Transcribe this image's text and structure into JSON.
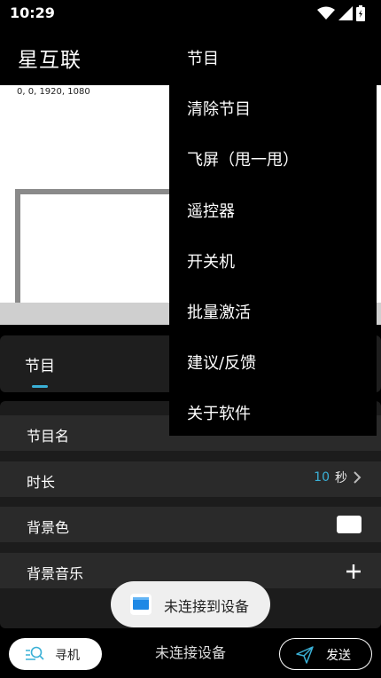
{
  "status": {
    "time": "10:29"
  },
  "app": {
    "title": "星互联"
  },
  "preview": {
    "coords": "0, 0, 1920, 1080"
  },
  "tabs": {
    "active": "节目"
  },
  "settings": {
    "program_name_label": "节目名",
    "duration_label": "时长",
    "duration_value": "10",
    "duration_unit": "秒",
    "background_color_label": "背景色",
    "background_music_label": "背景音乐"
  },
  "toast": {
    "text": "未连接到设备"
  },
  "bottom": {
    "search_label": "寻机",
    "status": "未连接设备",
    "send_label": "发送"
  },
  "menu": {
    "items": [
      "节目",
      "清除节目",
      "飞屏（甩一甩）",
      "遥控器",
      "开关机",
      "批量激活",
      "建议/反馈",
      "关于软件"
    ]
  },
  "colors": {
    "accent": "#3ab0d6",
    "background": "#000000",
    "row": "#2a2a2a"
  }
}
